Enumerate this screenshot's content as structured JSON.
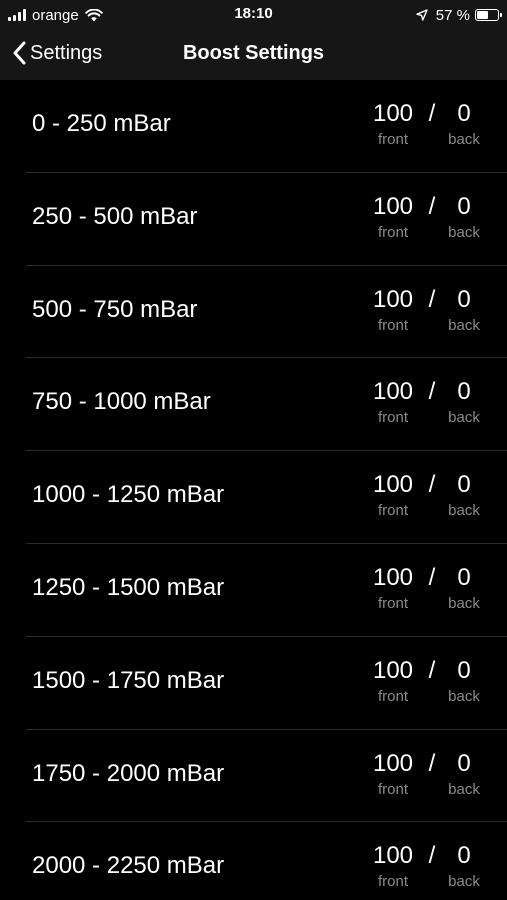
{
  "status_bar": {
    "carrier": "orange",
    "time": "18:10",
    "battery_text": "57 %",
    "battery_level_percent": 57,
    "signal_icon": "signal-bars-icon",
    "wifi_icon": "wifi-icon",
    "location_icon": "location-arrow-icon",
    "battery_icon": "battery-icon"
  },
  "nav": {
    "back_label": "Settings",
    "back_icon": "chevron-left-icon",
    "title": "Boost Settings"
  },
  "colors": {
    "background": "#000000",
    "bar_background": "#161616",
    "separator": "#2a2a2a",
    "primary_text": "#ffffff",
    "secondary_text": "#8a8a8a"
  },
  "list": {
    "items": [
      {
        "label": "0 - 250 mBar",
        "front": "100",
        "separator": "/",
        "back": "0",
        "front_caption": "front",
        "back_caption": "back"
      },
      {
        "label": "250 - 500 mBar",
        "front": "100",
        "separator": "/",
        "back": "0",
        "front_caption": "front",
        "back_caption": "back"
      },
      {
        "label": "500 - 750 mBar",
        "front": "100",
        "separator": "/",
        "back": "0",
        "front_caption": "front",
        "back_caption": "back"
      },
      {
        "label": "750 - 1000 mBar",
        "front": "100",
        "separator": "/",
        "back": "0",
        "front_caption": "front",
        "back_caption": "back"
      },
      {
        "label": "1000 - 1250 mBar",
        "front": "100",
        "separator": "/",
        "back": "0",
        "front_caption": "front",
        "back_caption": "back"
      },
      {
        "label": "1250 - 1500 mBar",
        "front": "100",
        "separator": "/",
        "back": "0",
        "front_caption": "front",
        "back_caption": "back"
      },
      {
        "label": "1500 - 1750 mBar",
        "front": "100",
        "separator": "/",
        "back": "0",
        "front_caption": "front",
        "back_caption": "back"
      },
      {
        "label": "1750 - 2000 mBar",
        "front": "100",
        "separator": "/",
        "back": "0",
        "front_caption": "front",
        "back_caption": "back"
      },
      {
        "label": "2000 - 2250 mBar",
        "front": "100",
        "separator": "/",
        "back": "0",
        "front_caption": "front",
        "back_caption": "back"
      }
    ]
  }
}
